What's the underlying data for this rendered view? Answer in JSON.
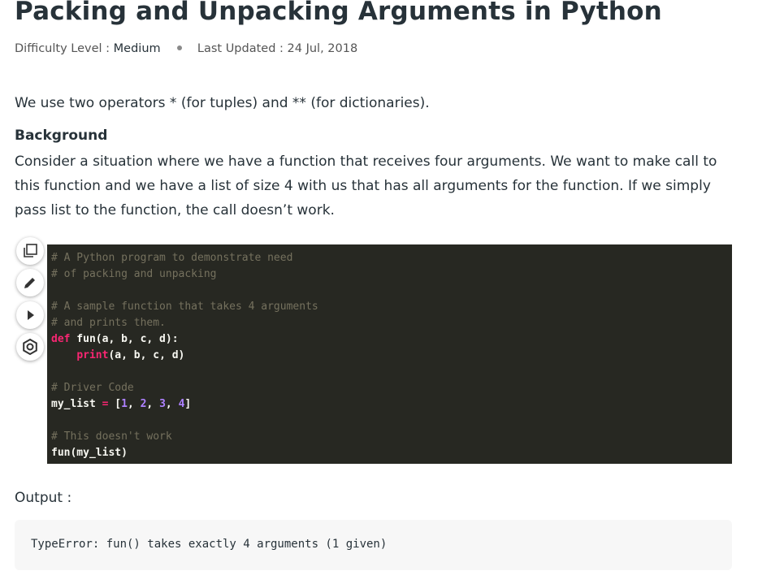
{
  "article": {
    "title": "Packing and Unpacking Arguments in Python",
    "difficulty_label": "Difficulty Level :",
    "difficulty_value": "Medium",
    "updated_label": "Last Updated :",
    "updated_value": "24 Jul, 2018",
    "intro": "We use two operators * (for tuples) and ** (for dictionaries).",
    "background_heading": "Background",
    "background_text": "Consider a situation where we have a function that receives four arguments. We want to make call to this function and we have a list of size 4 with us that has all arguments for the function. If we simply pass list to the function, the call doesn’t work."
  },
  "code_tools": {
    "icons": [
      "copy-icon",
      "edit-icon",
      "run-icon",
      "settings-icon"
    ]
  },
  "code": {
    "c1": "# A Python program to demonstrate need",
    "c2": "# of packing and unpacking",
    "c3": "# A sample function that takes 4 arguments",
    "c4": "# and prints them.",
    "def_kw": "def",
    "def_rest": " fun(a, b, c, d):",
    "print_indent": "    ",
    "print_kw": "print",
    "print_rest": "(a, b, c, d)",
    "c5": "# Driver Code",
    "list_name": "my_list ",
    "list_eq": "=",
    "list_open": " [",
    "n1": "1",
    "n2": "2",
    "n3": "3",
    "n4": "4",
    "sep": ", ",
    "list_close": "]",
    "c6": "# This doesn't work",
    "call": "fun(my_list)"
  },
  "output": {
    "label": "Output :",
    "text": "TypeError: fun() takes exactly 4 arguments (1 given)"
  },
  "colors": {
    "code_bg": "#272822",
    "comment": "#75715e",
    "keyword": "#f92672",
    "number": "#ae81ff",
    "output_bg": "#f7f7f7"
  }
}
